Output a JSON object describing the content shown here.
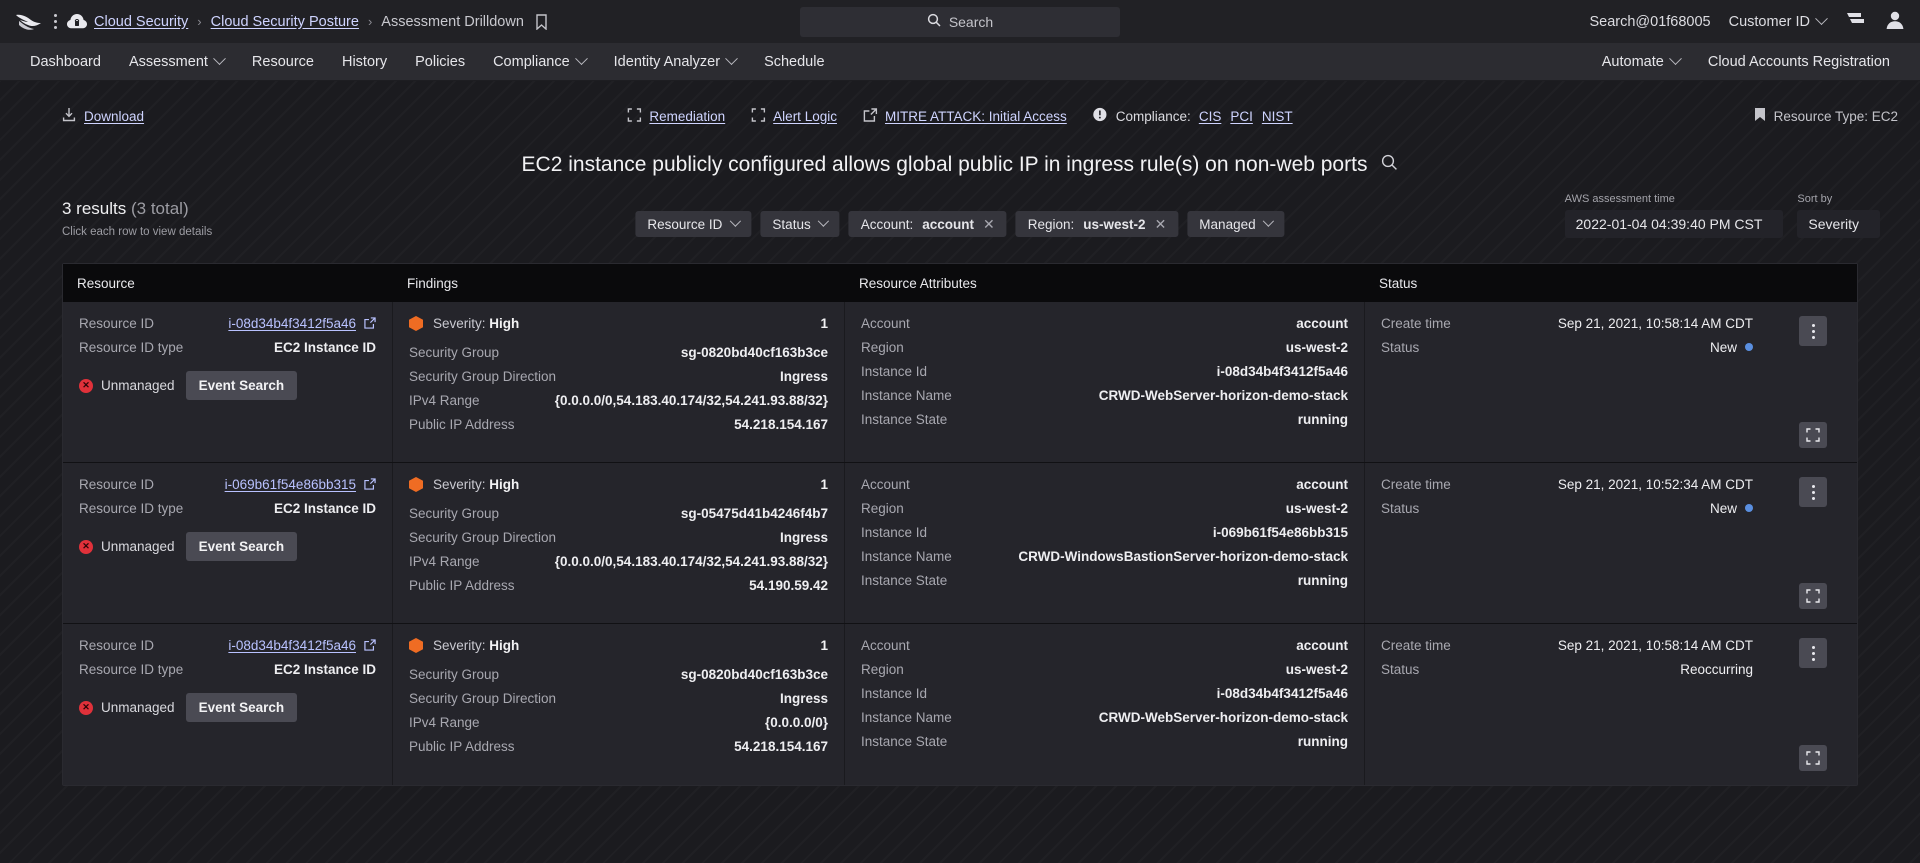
{
  "topbar": {
    "breadcrumbs": [
      {
        "label": "Cloud Security",
        "link": true
      },
      {
        "label": "Cloud Security Posture",
        "link": true
      },
      {
        "label": "Assessment Drilldown",
        "link": false
      }
    ],
    "separator": "›",
    "search_placeholder": "Search",
    "user_search": "Search@01f68005",
    "customer_id_label": "Customer ID"
  },
  "nav": {
    "items": [
      {
        "label": "Dashboard",
        "caret": false
      },
      {
        "label": "Assessment",
        "caret": true
      },
      {
        "label": "Resource",
        "caret": false
      },
      {
        "label": "History",
        "caret": false
      },
      {
        "label": "Policies",
        "caret": false
      },
      {
        "label": "Compliance",
        "caret": true
      },
      {
        "label": "Identity Analyzer",
        "caret": true
      },
      {
        "label": "Schedule",
        "caret": false
      }
    ],
    "right_items": [
      {
        "label": "Automate",
        "caret": true
      },
      {
        "label": "Cloud Accounts Registration",
        "caret": false
      }
    ]
  },
  "toolbar": {
    "download": "Download",
    "remediation": "Remediation",
    "alert_logic": "Alert Logic",
    "mitre": "MITRE ATTACK: Initial Access",
    "compliance_label": "Compliance:",
    "compliance_links": [
      "CIS",
      "PCI",
      "NIST"
    ],
    "resource_type": "Resource Type: EC2"
  },
  "page": {
    "title": "EC2 instance publicly configured allows global public IP in ingress rule(s) on non-web ports",
    "results_count": "3 results",
    "results_total": "(3 total)",
    "results_hint": "Click each row to view details"
  },
  "filters": {
    "chips": [
      {
        "label": "Resource ID",
        "value": "",
        "caret": true,
        "close": false
      },
      {
        "label": "Status",
        "value": "",
        "caret": true,
        "close": false
      },
      {
        "label": "Account:",
        "value": "account",
        "caret": false,
        "close": true
      },
      {
        "label": "Region:",
        "value": "us-west-2",
        "caret": false,
        "close": true
      },
      {
        "label": "Managed",
        "value": "",
        "caret": true,
        "close": false
      }
    ],
    "assessment_time_label": "AWS assessment time",
    "assessment_time_value": "2022-01-04 04:39:40 PM CST",
    "sort_by_label": "Sort by",
    "sort_by_value": "Severity"
  },
  "table": {
    "headers": [
      "Resource",
      "Findings",
      "Resource Attributes",
      "Status"
    ],
    "labels": {
      "resource_id": "Resource ID",
      "resource_id_type": "Resource ID type",
      "unmanaged": "Unmanaged",
      "event_search": "Event Search",
      "severity_prefix": "Severity:",
      "security_group": "Security Group",
      "security_group_direction": "Security Group Direction",
      "ipv4_range": "IPv4 Range",
      "public_ip": "Public IP Address",
      "account": "Account",
      "region": "Region",
      "instance_id": "Instance Id",
      "instance_name": "Instance Name",
      "instance_state": "Instance State",
      "create_time": "Create time",
      "status": "Status"
    },
    "rows": [
      {
        "resource_id": "i-08d34b4f3412f5a46",
        "resource_id_type": "EC2 Instance ID",
        "managed_state": "Unmanaged",
        "severity": "High",
        "finding_count": "1",
        "security_group": "sg-0820bd40cf163b3ce",
        "security_group_direction": "Ingress",
        "ipv4_range": "{0.0.0.0/0,54.183.40.174/32,54.241.93.88/32}",
        "public_ip": "54.218.154.167",
        "account": "account",
        "region": "us-west-2",
        "instance_id": "i-08d34b4f3412f5a46",
        "instance_name": "CRWD-WebServer-horizon-demo-stack",
        "instance_state": "running",
        "create_time": "Sep 21, 2021, 10:58:14 AM CDT",
        "status": "New",
        "status_dot": true
      },
      {
        "resource_id": "i-069b61f54e86bb315",
        "resource_id_type": "EC2 Instance ID",
        "managed_state": "Unmanaged",
        "severity": "High",
        "finding_count": "1",
        "security_group": "sg-05475d41b4246f4b7",
        "security_group_direction": "Ingress",
        "ipv4_range": "{0.0.0.0/0,54.183.40.174/32,54.241.93.88/32}",
        "public_ip": "54.190.59.42",
        "account": "account",
        "region": "us-west-2",
        "instance_id": "i-069b61f54e86bb315",
        "instance_name": "CRWD-WindowsBastionServer-horizon-demo-stack",
        "instance_state": "running",
        "create_time": "Sep 21, 2021, 10:52:34 AM CDT",
        "status": "New",
        "status_dot": true
      },
      {
        "resource_id": "i-08d34b4f3412f5a46",
        "resource_id_type": "EC2 Instance ID",
        "managed_state": "Unmanaged",
        "severity": "High",
        "finding_count": "1",
        "security_group": "sg-0820bd40cf163b3ce",
        "security_group_direction": "Ingress",
        "ipv4_range": "{0.0.0.0/0}",
        "public_ip": "54.218.154.167",
        "account": "account",
        "region": "us-west-2",
        "instance_id": "i-08d34b4f3412f5a46",
        "instance_name": "CRWD-WebServer-horizon-demo-stack",
        "instance_state": "running",
        "create_time": "Sep 21, 2021, 10:58:14 AM CDT",
        "status": "Reoccurring",
        "status_dot": false
      }
    ]
  },
  "colors": {
    "severity_high": "#ef6c23",
    "link": "#cfd4ff",
    "status_new": "#5a8fe0",
    "unmanaged": "#e0313a"
  }
}
